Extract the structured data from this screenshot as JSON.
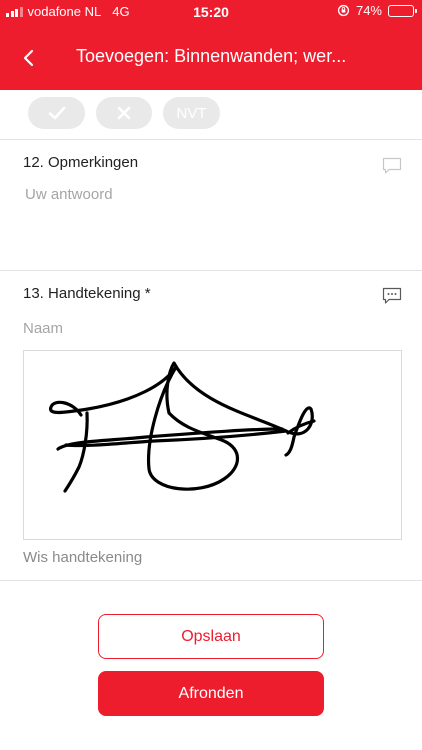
{
  "status_bar": {
    "carrier": "vodafone NL",
    "network": "4G",
    "time": "15:20",
    "battery": "74%",
    "battery_level": 0.74
  },
  "header": {
    "title": "Toevoegen: Binnenwanden; wer...",
    "background_color": "#ee1d2d"
  },
  "answer_chips": {
    "na_label": "NVT"
  },
  "question_12": {
    "title": "12. Opmerkingen",
    "placeholder": "Uw antwoord"
  },
  "question_13": {
    "title": "13. Handtekening *",
    "name_placeholder": "Naam",
    "clear_label": "Wis handtekening"
  },
  "actions": {
    "save_label": "Opslaan",
    "finish_label": "Afronden"
  },
  "colors": {
    "accent": "#ee1d2d",
    "chip_background": "#e9e9e9",
    "placeholder": "#a5a5a5"
  }
}
